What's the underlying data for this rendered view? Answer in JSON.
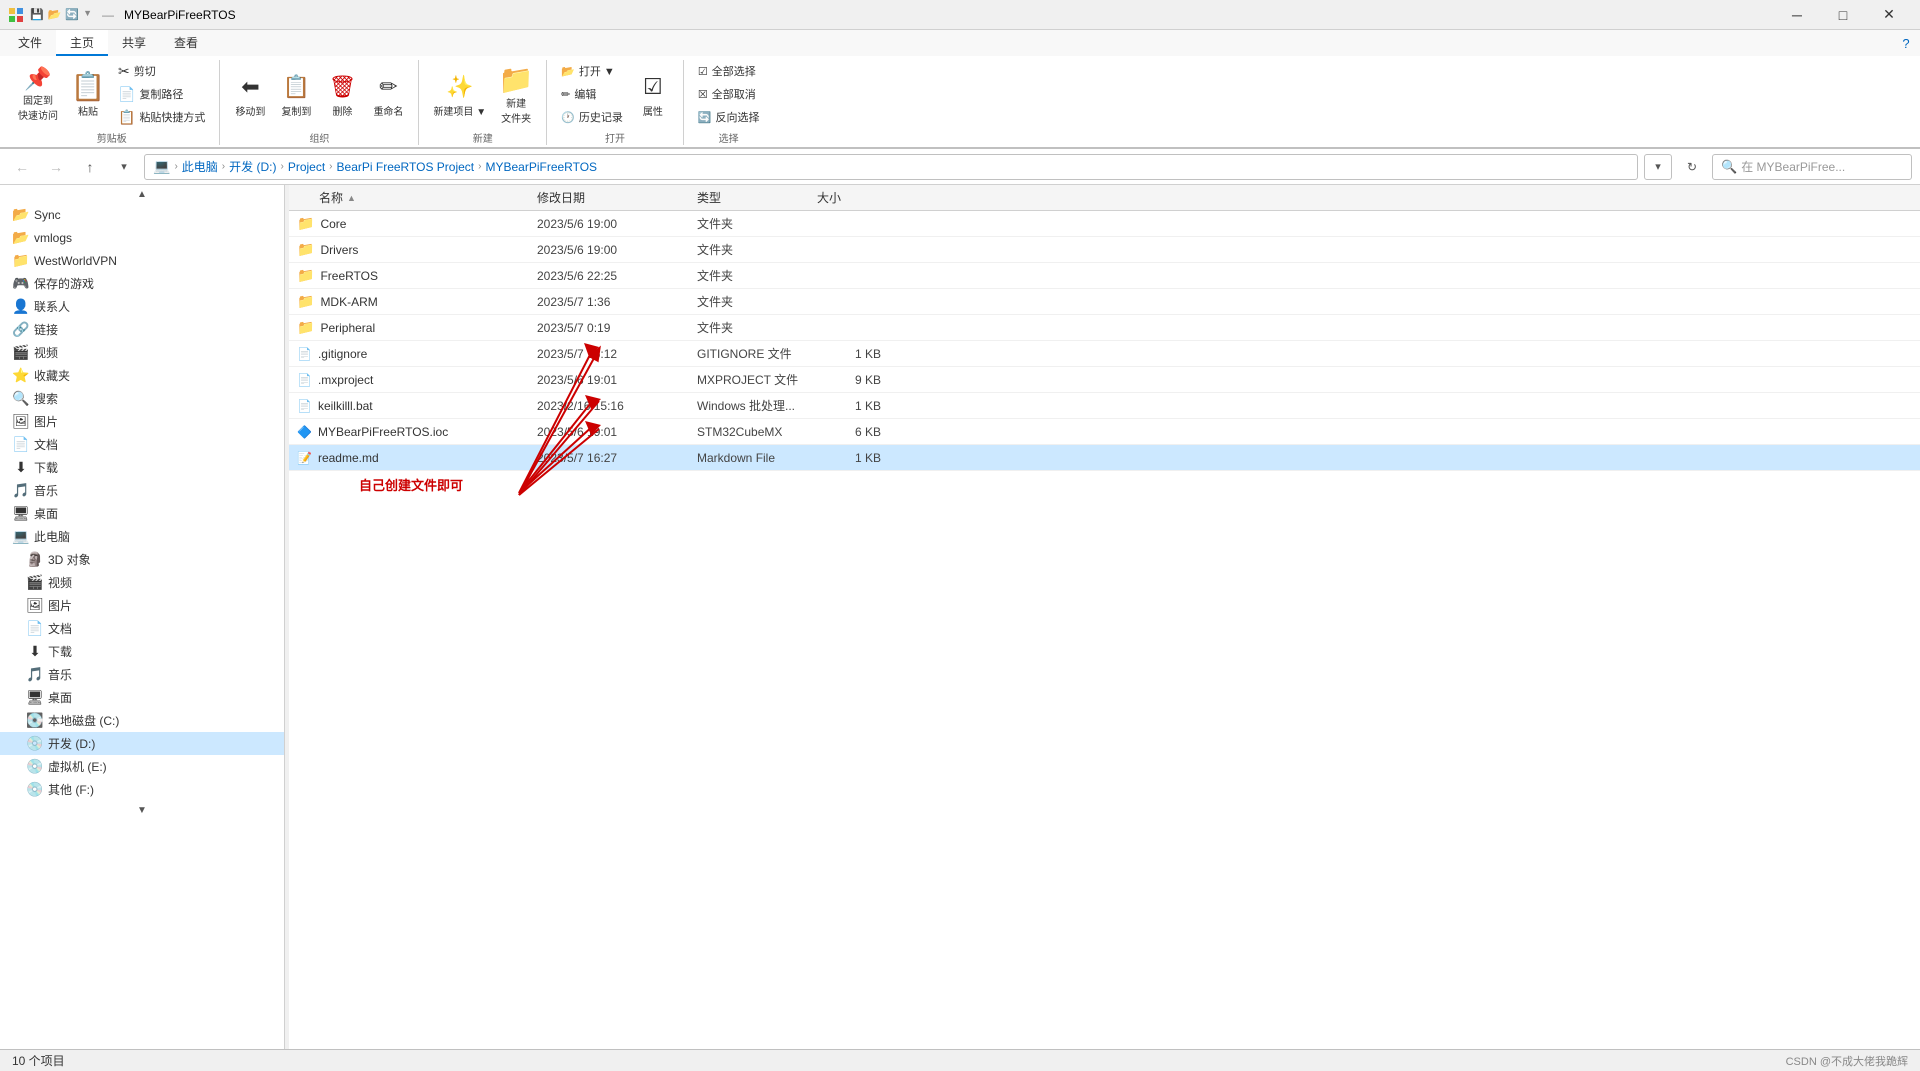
{
  "window": {
    "title": "MYBearPiFreeRTOS",
    "quick_access_icons": [
      "💾",
      "📂",
      "🔄"
    ],
    "controls": [
      "─",
      "□",
      "✕"
    ]
  },
  "ribbon": {
    "tabs": [
      "文件",
      "主页",
      "共享",
      "查看"
    ],
    "active_tab": "主页",
    "groups": [
      {
        "label": "剪贴板",
        "items": [
          {
            "type": "big",
            "icon": "📌",
            "label": "固定到\n快速访问",
            "ico_class": "ico-pin"
          },
          {
            "type": "big",
            "icon": "📋",
            "label": "粘贴",
            "ico_class": "ico-paste"
          },
          {
            "type": "sm",
            "icon": "✂",
            "label": "剪切"
          },
          {
            "type": "sm",
            "icon": "📄",
            "label": "复制路径"
          },
          {
            "type": "sm",
            "icon": "📋",
            "label": "粘贴快捷方式"
          }
        ]
      },
      {
        "label": "组织",
        "items": [
          {
            "type": "big",
            "icon": "⬅",
            "label": "移动到",
            "ico_class": "ico-move"
          },
          {
            "type": "big",
            "icon": "📋",
            "label": "复制到"
          },
          {
            "type": "big",
            "icon": "🗑",
            "label": "删除",
            "ico_class": "ico-delete"
          },
          {
            "type": "big",
            "icon": "✏",
            "label": "重命名"
          }
        ]
      },
      {
        "label": "新建",
        "items": [
          {
            "type": "big",
            "icon": "✨",
            "label": "新建\n项目▼"
          },
          {
            "type": "big",
            "icon": "📁",
            "label": "新建\n文件夹",
            "ico_class": "folder-icon"
          }
        ]
      },
      {
        "label": "打开",
        "items": [
          {
            "type": "sm",
            "icon": "📂",
            "label": "打开▼"
          },
          {
            "type": "sm",
            "icon": "✏",
            "label": "编辑"
          },
          {
            "type": "sm",
            "icon": "🕐",
            "label": "历史记录"
          },
          {
            "type": "big",
            "icon": "🔑",
            "label": "属性",
            "ico_class": "ico-properties"
          }
        ]
      },
      {
        "label": "选择",
        "items": [
          {
            "type": "sm",
            "icon": "☑",
            "label": "全部选择"
          },
          {
            "type": "sm",
            "icon": "☒",
            "label": "全部取消"
          },
          {
            "type": "sm",
            "icon": "🔄",
            "label": "反向选择"
          }
        ]
      }
    ]
  },
  "nav": {
    "back_label": "←",
    "forward_label": "→",
    "up_label": "↑",
    "breadcrumb": [
      "此电脑",
      "开发 (D:)",
      "Project",
      "BearPi FreeRTOS Project",
      "MYBearPiFreeRTOS"
    ],
    "search_placeholder": "在 MYBearPiFree...",
    "refresh_label": "↻"
  },
  "sidebar": {
    "scroll_up": "▲",
    "items": [
      {
        "icon": "📂",
        "label": "Sync"
      },
      {
        "icon": "📂",
        "label": "vmlogs"
      },
      {
        "icon": "📁",
        "label": "WestWorldVPN"
      },
      {
        "icon": "🎮",
        "label": "保存的游戏"
      },
      {
        "icon": "👤",
        "label": "联系人"
      },
      {
        "icon": "🔗",
        "label": "链接"
      },
      {
        "icon": "🎬",
        "label": "视频"
      },
      {
        "icon": "⭐",
        "label": "收藏夹"
      },
      {
        "icon": "🔍",
        "label": "搜索"
      },
      {
        "icon": "🖼",
        "label": "图片"
      },
      {
        "icon": "📄",
        "label": "文档"
      },
      {
        "icon": "⬇",
        "label": "下载"
      },
      {
        "icon": "🎵",
        "label": "音乐"
      },
      {
        "icon": "🖥",
        "label": "桌面"
      },
      {
        "icon": "💻",
        "label": "此电脑"
      },
      {
        "icon": "🗿",
        "label": "3D 对象"
      },
      {
        "icon": "🎬",
        "label": "视频"
      },
      {
        "icon": "🖼",
        "label": "图片"
      },
      {
        "icon": "📄",
        "label": "文档"
      },
      {
        "icon": "⬇",
        "label": "下载"
      },
      {
        "icon": "🎵",
        "label": "音乐"
      },
      {
        "icon": "🖥",
        "label": "桌面"
      },
      {
        "icon": "💽",
        "label": "本地磁盘 (C:)"
      },
      {
        "icon": "💿",
        "label": "开发 (D:)",
        "selected": true
      },
      {
        "icon": "💿",
        "label": "虚拟机 (E:)"
      },
      {
        "icon": "💿",
        "label": "其他 (F:)"
      }
    ]
  },
  "file_list": {
    "columns": [
      {
        "label": "名称",
        "sort_arrow": "▲"
      },
      {
        "label": "修改日期"
      },
      {
        "label": "类型"
      },
      {
        "label": "大小"
      }
    ],
    "files": [
      {
        "icon": "📁",
        "icon_class": "folder-icon",
        "name": "Core",
        "date": "2023/5/6 19:00",
        "type": "文件夹",
        "size": ""
      },
      {
        "icon": "📁",
        "icon_class": "folder-icon",
        "name": "Drivers",
        "date": "2023/5/6 19:00",
        "type": "文件夹",
        "size": ""
      },
      {
        "icon": "📁",
        "icon_class": "folder-icon",
        "name": "FreeRTOS",
        "date": "2023/5/6 22:25",
        "type": "文件夹",
        "size": ""
      },
      {
        "icon": "📁",
        "icon_class": "folder-icon",
        "name": "MDK-ARM",
        "date": "2023/5/7 1:36",
        "type": "文件夹",
        "size": ""
      },
      {
        "icon": "📁",
        "icon_class": "folder-icon",
        "name": "Peripheral",
        "date": "2023/5/7 0:19",
        "type": "文件夹",
        "size": ""
      },
      {
        "icon": "📄",
        "icon_class": "file-icon-white",
        "name": ".gitignore",
        "date": "2023/5/7 16:12",
        "type": "GITIGNORE 文件",
        "size": "1 KB"
      },
      {
        "icon": "📄",
        "icon_class": "file-icon-white",
        "name": ".mxproject",
        "date": "2023/5/6 19:01",
        "type": "MXPROJECT 文件",
        "size": "9 KB"
      },
      {
        "icon": "📄",
        "icon_class": "file-icon-white",
        "name": "keilkilll.bat",
        "date": "2023/2/16 15:16",
        "type": "Windows 批处理...",
        "size": "1 KB"
      },
      {
        "icon": "🔷",
        "icon_class": "file-icon-mx",
        "name": "MYBearPiFreeRTOS.ioc",
        "date": "2023/5/6 19:01",
        "type": "STM32CubeMX",
        "size": "6 KB"
      },
      {
        "icon": "📝",
        "icon_class": "file-icon-md",
        "name": "readme.md",
        "date": "2023/5/7 16:27",
        "type": "Markdown File",
        "size": "1 KB",
        "selected": true
      }
    ]
  },
  "annotation": {
    "label": "自己创建文件即可",
    "color": "#cc0000"
  },
  "status_bar": {
    "items_count": "10 个项目",
    "watermark": "CSDN @不成大佬我跪辉"
  }
}
